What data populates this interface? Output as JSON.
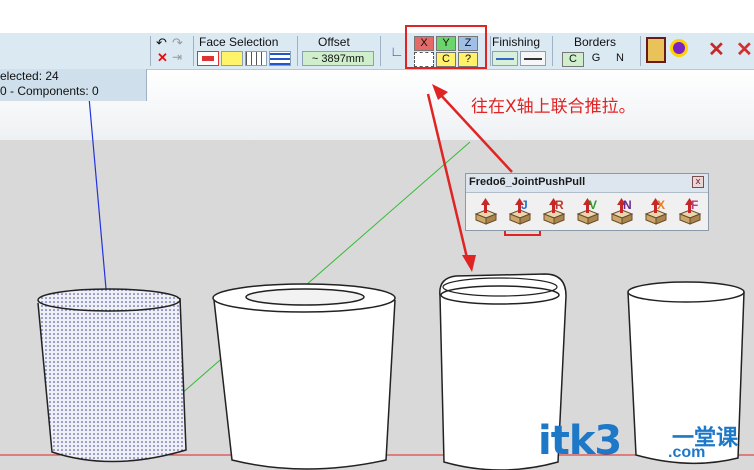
{
  "status": {
    "selected": "elected: 24",
    "components": "0 - Components: 0"
  },
  "toolbar": {
    "face_selection_label": "Face Selection",
    "offset_label": "Offset",
    "offset_value": "~ 3897mm",
    "axis_x": "X",
    "axis_y": "Y",
    "axis_z": "Z",
    "axis_c": "C",
    "axis_q": "?",
    "finishing_label": "Finishing",
    "borders_label": "Borders",
    "border_c": "C",
    "border_g": "G",
    "border_n": "N"
  },
  "palette": {
    "title": "Fredo6_JointPushPull",
    "close": "x",
    "tools": [
      {
        "letter": "",
        "color": "#c0392b"
      },
      {
        "letter": "J",
        "color": "#1f6fd1"
      },
      {
        "letter": "R",
        "color": "#c0392b"
      },
      {
        "letter": "V",
        "color": "#2a9d2a"
      },
      {
        "letter": "N",
        "color": "#6b2a8a"
      },
      {
        "letter": "X",
        "color": "#e67e22"
      },
      {
        "letter": "F",
        "color": "#c0397b"
      }
    ]
  },
  "annotation": "往在X轴上联合推拉。",
  "watermark": {
    "main": "itk3",
    "cn": "一堂课",
    "com": ".com"
  },
  "colors": {
    "annotation_red": "#e02424",
    "watermark_blue": "#1e78c8",
    "axis_blue": "#2233dd",
    "axis_green": "#33bb33",
    "axis_red": "#dd2222"
  }
}
